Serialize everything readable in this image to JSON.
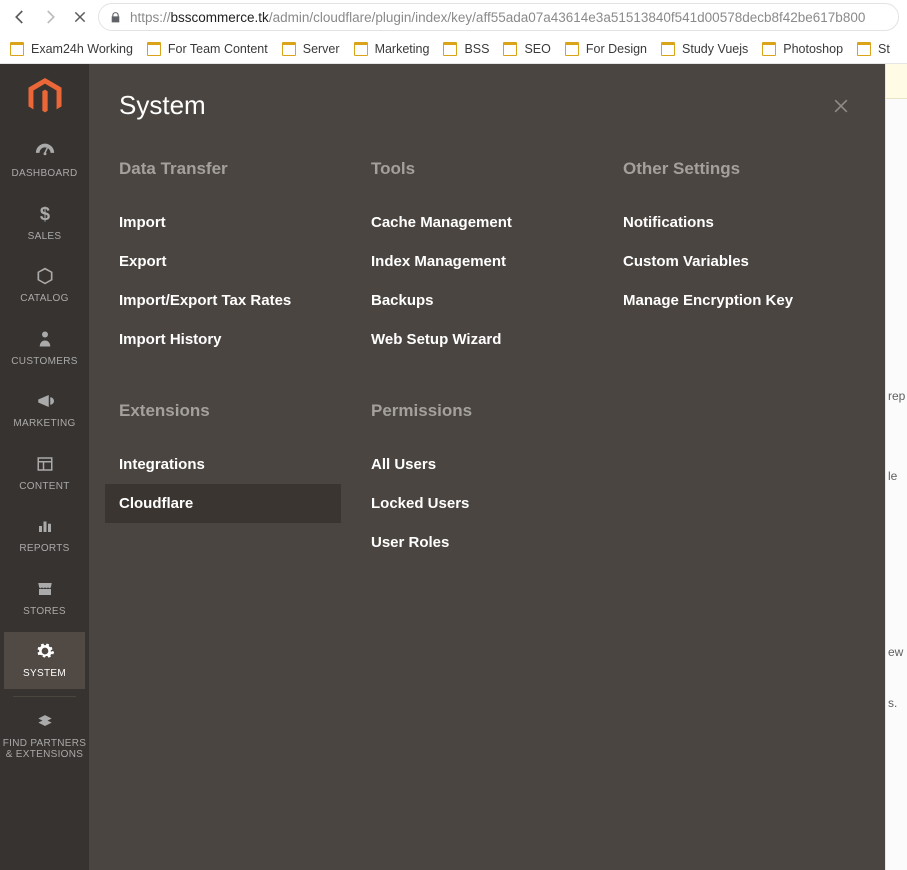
{
  "browser": {
    "url_scheme": "https://",
    "url_host": "bsscommerce.tk",
    "url_path": "/admin/cloudflare/plugin/index/key/aff55ada07a43614e3a51513840f541d00578decb8f42be617b800",
    "bookmarks": [
      "Exam24h Working",
      "For Team Content",
      "Server",
      "Marketing",
      "BSS",
      "SEO",
      "For Design",
      "Study Vuejs",
      "Photoshop",
      "St"
    ]
  },
  "sidebar": {
    "items": [
      {
        "label": "DASHBOARD"
      },
      {
        "label": "SALES"
      },
      {
        "label": "CATALOG"
      },
      {
        "label": "CUSTOMERS"
      },
      {
        "label": "MARKETING"
      },
      {
        "label": "CONTENT"
      },
      {
        "label": "REPORTS"
      },
      {
        "label": "STORES"
      },
      {
        "label": "SYSTEM"
      },
      {
        "label": "FIND PARTNERS & EXTENSIONS"
      }
    ]
  },
  "flyout": {
    "title": "System",
    "columns": [
      {
        "sections": [
          {
            "title": "Data Transfer",
            "items": [
              "Import",
              "Export",
              "Import/Export Tax Rates",
              "Import History"
            ]
          },
          {
            "title": "Extensions",
            "items": [
              "Integrations",
              "Cloudflare"
            ],
            "active_index": 1
          }
        ]
      },
      {
        "sections": [
          {
            "title": "Tools",
            "items": [
              "Cache Management",
              "Index Management",
              "Backups",
              "Web Setup Wizard"
            ]
          },
          {
            "title": "Permissions",
            "items": [
              "All Users",
              "Locked Users",
              "User Roles"
            ]
          }
        ]
      },
      {
        "sections": [
          {
            "title": "Other Settings",
            "items": [
              "Notifications",
              "Custom Variables",
              "Manage Encryption Key"
            ]
          }
        ]
      }
    ]
  },
  "page_fragments": {
    "a": "rep",
    "b": "le",
    "c": "ew",
    "d": "s."
  }
}
